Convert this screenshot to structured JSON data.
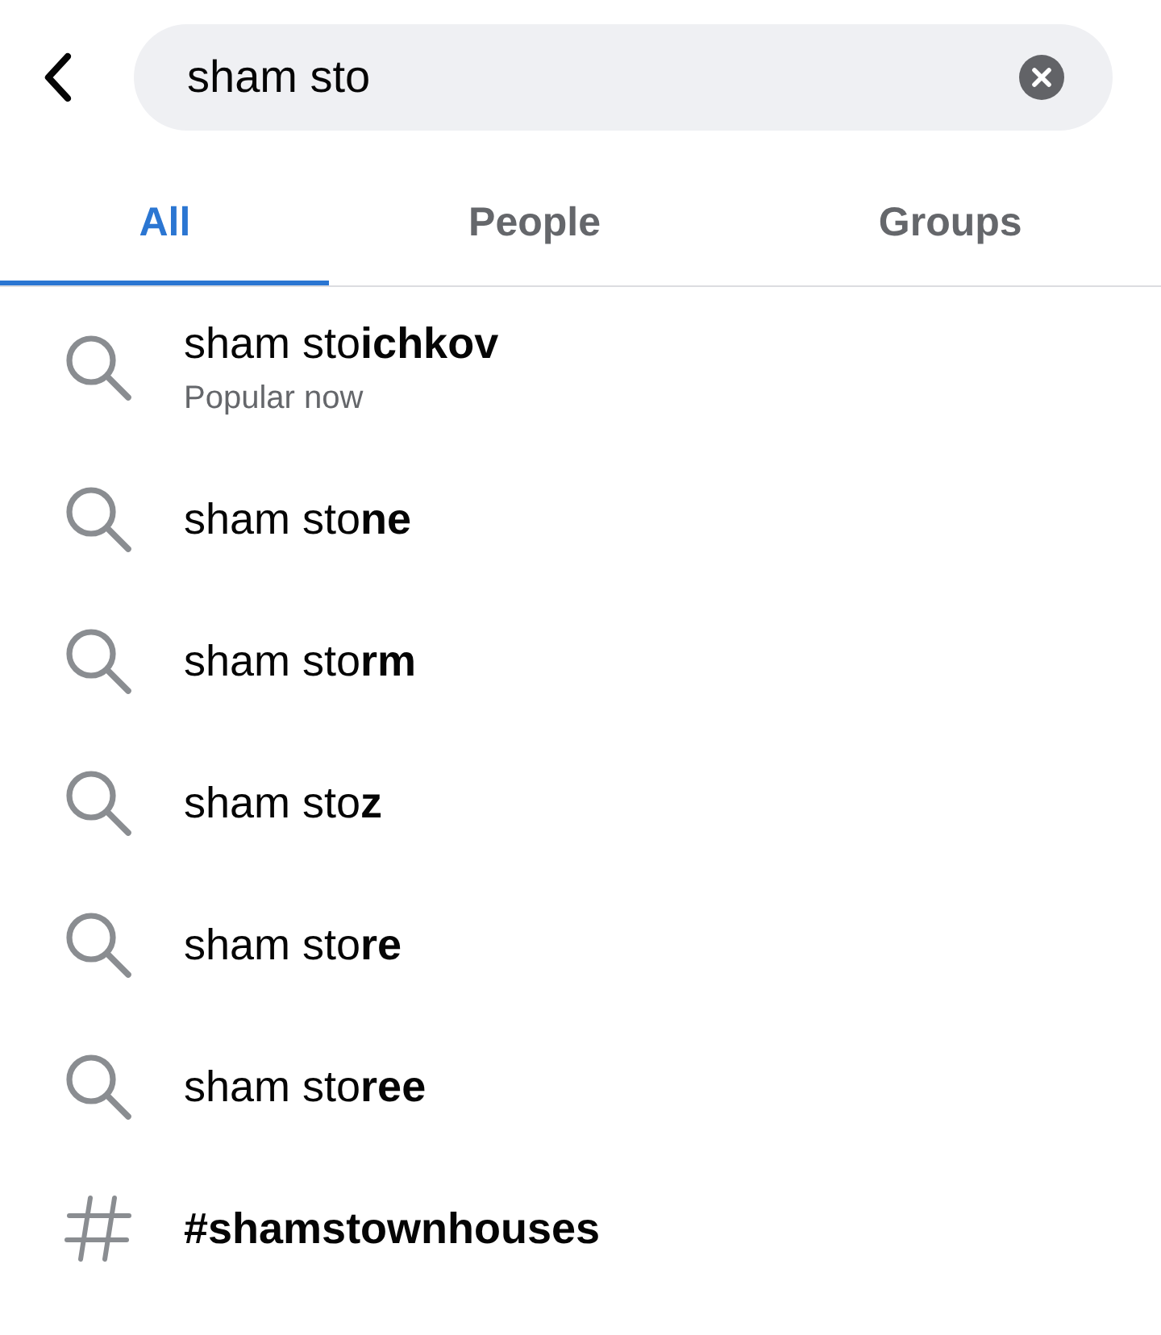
{
  "search": {
    "value": "sham sto"
  },
  "tabs": [
    {
      "label": "All",
      "selected": true
    },
    {
      "label": "People",
      "selected": false
    },
    {
      "label": "Groups",
      "selected": false
    }
  ],
  "results": [
    {
      "kind": "query",
      "text": "sham sto**ichkov**",
      "subtitle": "Popular now"
    },
    {
      "kind": "query",
      "text": "sham sto**ne**"
    },
    {
      "kind": "query",
      "text": "sham sto**rm**"
    },
    {
      "kind": "query",
      "text": "sham sto**z**"
    },
    {
      "kind": "query",
      "text": "sham sto**re**"
    },
    {
      "kind": "query",
      "text": "sham sto**ree**"
    },
    {
      "kind": "hashtag",
      "text": "#shamstownhouses"
    }
  ]
}
